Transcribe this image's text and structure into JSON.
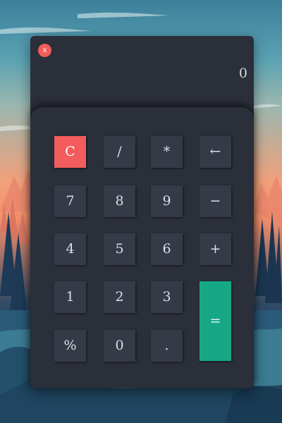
{
  "window": {
    "close_label": "x",
    "display_value": "0"
  },
  "keys": {
    "clear": "C",
    "divide": "/",
    "multiply": "*",
    "backspace": "←",
    "seven": "7",
    "eight": "8",
    "nine": "9",
    "minus": "−",
    "four": "4",
    "five": "5",
    "six": "6",
    "plus": "+",
    "one": "1",
    "two": "2",
    "three": "3",
    "equals": "=",
    "percent": "%",
    "zero": "0",
    "decimal": "."
  },
  "colors": {
    "window_bg": "#2b2f39",
    "key_bg": "#353a46",
    "clear_key": "#f25c5c",
    "equals_key": "#16a885",
    "close_button": "#f25c5c"
  }
}
